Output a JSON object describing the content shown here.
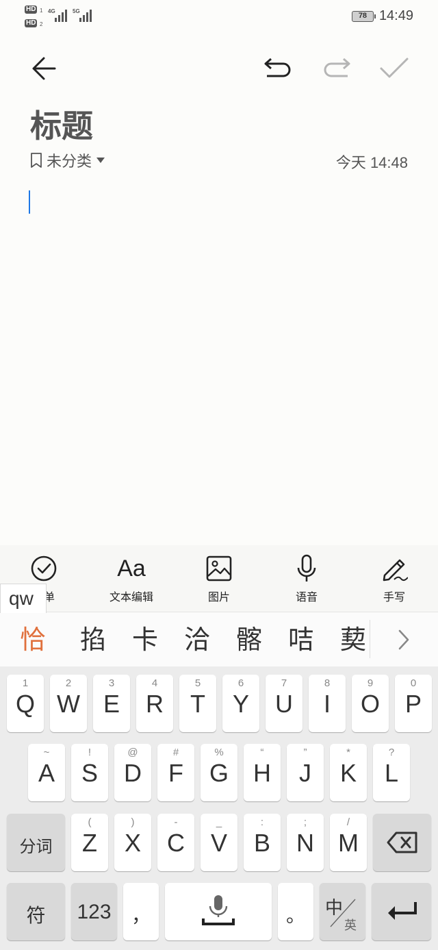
{
  "status_bar": {
    "sim1": "HD",
    "sim1_index": "1",
    "sim2": "HD",
    "sim2_index": "2",
    "net1": "4G",
    "net2": "5G",
    "battery": "78",
    "time": "14:49"
  },
  "toolbar": {
    "back_icon": "arrow-left-icon",
    "undo_icon": "undo-icon",
    "redo_icon": "redo-icon",
    "done_icon": "checkmark-icon"
  },
  "note": {
    "title": "标题",
    "category": "未分类",
    "date": "今天 14:48"
  },
  "tools": [
    {
      "icon": "checklist-icon",
      "label": "清单"
    },
    {
      "icon": "text-format-icon",
      "glyph": "Aa",
      "label": "文本编辑"
    },
    {
      "icon": "image-icon",
      "label": "图片"
    },
    {
      "icon": "microphone-icon",
      "label": "语音"
    },
    {
      "icon": "handwriting-pen-icon",
      "label": "手写"
    }
  ],
  "ime": {
    "pinyin": "qw",
    "candidates": [
      "恰",
      "掐",
      "卡",
      "洽",
      "髂",
      "咭",
      "葜"
    ],
    "highlight_color": "#e0703c",
    "rows": [
      [
        {
          "k": "Q",
          "h": "1"
        },
        {
          "k": "W",
          "h": "2"
        },
        {
          "k": "E",
          "h": "3"
        },
        {
          "k": "R",
          "h": "4"
        },
        {
          "k": "T",
          "h": "5"
        },
        {
          "k": "Y",
          "h": "6"
        },
        {
          "k": "U",
          "h": "7"
        },
        {
          "k": "I",
          "h": "8"
        },
        {
          "k": "O",
          "h": "9"
        },
        {
          "k": "P",
          "h": "0"
        }
      ],
      [
        {
          "k": "A",
          "h": "~"
        },
        {
          "k": "S",
          "h": "!"
        },
        {
          "k": "D",
          "h": "@"
        },
        {
          "k": "F",
          "h": "#"
        },
        {
          "k": "G",
          "h": "%"
        },
        {
          "k": "H",
          "h": "“"
        },
        {
          "k": "J",
          "h": "”"
        },
        {
          "k": "K",
          "h": "*"
        },
        {
          "k": "L",
          "h": "?"
        }
      ],
      [
        {
          "k": "Z",
          "h": "("
        },
        {
          "k": "X",
          "h": ")"
        },
        {
          "k": "C",
          "h": "-"
        },
        {
          "k": "V",
          "h": "_"
        },
        {
          "k": "B",
          "h": ":"
        },
        {
          "k": "N",
          "h": ";"
        },
        {
          "k": "M",
          "h": "/"
        }
      ]
    ],
    "segment_key": "分词",
    "symbol_key": "符",
    "number_key": "123",
    "comma_key": "，",
    "period_key": "。",
    "lang_key_main": "中",
    "lang_key_sub": "英"
  }
}
